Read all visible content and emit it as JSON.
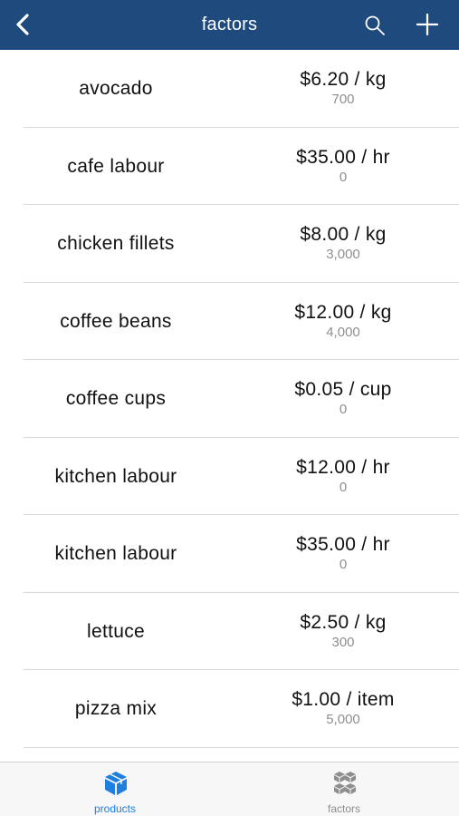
{
  "nav": {
    "title": "factors",
    "back_icon": "chevron-left-icon",
    "search_icon": "search-icon",
    "add_icon": "plus-icon",
    "background": "#1f4a7e"
  },
  "factors": [
    {
      "name": "avocado",
      "price": "$6.20 / kg",
      "quantity": "700"
    },
    {
      "name": "cafe labour",
      "price": "$35.00 / hr",
      "quantity": "0"
    },
    {
      "name": "chicken fillets",
      "price": "$8.00 / kg",
      "quantity": "3,000"
    },
    {
      "name": "coffee beans",
      "price": "$12.00 / kg",
      "quantity": "4,000"
    },
    {
      "name": "coffee cups",
      "price": "$0.05 / cup",
      "quantity": "0"
    },
    {
      "name": "kitchen labour",
      "price": "$12.00 / hr",
      "quantity": "0"
    },
    {
      "name": "kitchen labour",
      "price": "$35.00 / hr",
      "quantity": "0"
    },
    {
      "name": "lettuce",
      "price": "$2.50 / kg",
      "quantity": "300"
    },
    {
      "name": "pizza mix",
      "price": "$1.00 / item",
      "quantity": "5,000"
    }
  ],
  "tabbar": {
    "tabs": [
      {
        "label": "products",
        "icon": "cube-icon",
        "active": true,
        "color": "#1e7fe0"
      },
      {
        "label": "factors",
        "icon": "cubes-icon",
        "active": false,
        "color": "#8e8e8e"
      }
    ]
  }
}
